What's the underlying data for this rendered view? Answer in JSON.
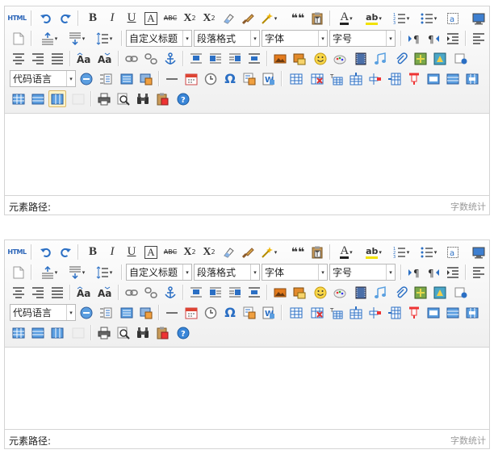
{
  "editors": [
    {
      "html_label": "HTML",
      "combos": {
        "code_language": "代码语言",
        "custom_title": "自定义标题",
        "paragraph_format": "段落格式",
        "font_family": "字体",
        "font_size": "字号"
      },
      "statusbar": {
        "element_path_label": "元素路径:",
        "word_count_label": "字数统计"
      }
    },
    {
      "html_label": "HTML",
      "combos": {
        "code_language": "代码语言",
        "custom_title": "自定义标题",
        "paragraph_format": "段落格式",
        "font_family": "字体",
        "font_size": "字号"
      },
      "statusbar": {
        "element_path_label": "元素路径:",
        "word_count_label": "字数统计"
      }
    }
  ],
  "glyphs": {
    "bold": "B",
    "italic": "I",
    "underline": "U",
    "font_border": "A",
    "strikethrough": "ABC",
    "superscript": "X",
    "sup_mark": "2",
    "subscript": "X",
    "sub_mark": "2",
    "quote": "❝❝",
    "font_color": "A",
    "omega": "Ω",
    "caret": "▾"
  },
  "icons": [
    "html-source-icon",
    "undo-icon",
    "redo-icon",
    "bold-icon",
    "italic-icon",
    "underline-icon",
    "font-border-icon",
    "strikethrough-icon",
    "superscript-icon",
    "subscript-icon",
    "eraser-icon",
    "format-brush-icon",
    "auto-typeset-icon",
    "blockquote-icon",
    "paste-plain-icon",
    "font-color-icon",
    "back-color-icon",
    "ordered-list-icon",
    "unordered-list-icon",
    "select-all-icon",
    "preview-icon",
    "clear-doc-icon",
    "row-spacing-top-icon",
    "row-spacing-bottom-icon",
    "line-height-icon",
    "direction-ltr-icon",
    "direction-rtl-icon",
    "indent-icon",
    "justify-left-icon",
    "justify-center-icon",
    "justify-right-icon",
    "justify-full-icon",
    "to-uppercase-icon",
    "to-lowercase-icon",
    "link-icon",
    "unlink-icon",
    "anchor-icon",
    "image-none-icon",
    "image-left-icon",
    "image-right-icon",
    "image-center-icon",
    "simple-upload-icon",
    "insert-image-icon",
    "emotion-icon",
    "scrawl-icon",
    "insert-video-icon",
    "music-icon",
    "attachment-icon",
    "map-icon",
    "gmap-icon",
    "insert-frame-icon",
    "insert-code-icon",
    "page-break-icon",
    "template-icon",
    "background-icon",
    "horizontal-icon",
    "date-icon",
    "time-icon",
    "special-chars-icon",
    "snapscreen-icon",
    "word-image-icon",
    "insert-table-icon",
    "delete-table-icon",
    "insert-paragraph-before-table-icon",
    "insert-row-icon",
    "delete-row-icon",
    "insert-col-icon",
    "delete-col-icon",
    "merge-cells-icon",
    "merge-right-icon",
    "merge-down-icon",
    "split-to-cells-icon",
    "split-to-rows-icon",
    "split-to-cols-icon",
    "charts-icon",
    "print-icon",
    "search-replace-icon",
    "help-icon",
    "drafts-icon"
  ]
}
